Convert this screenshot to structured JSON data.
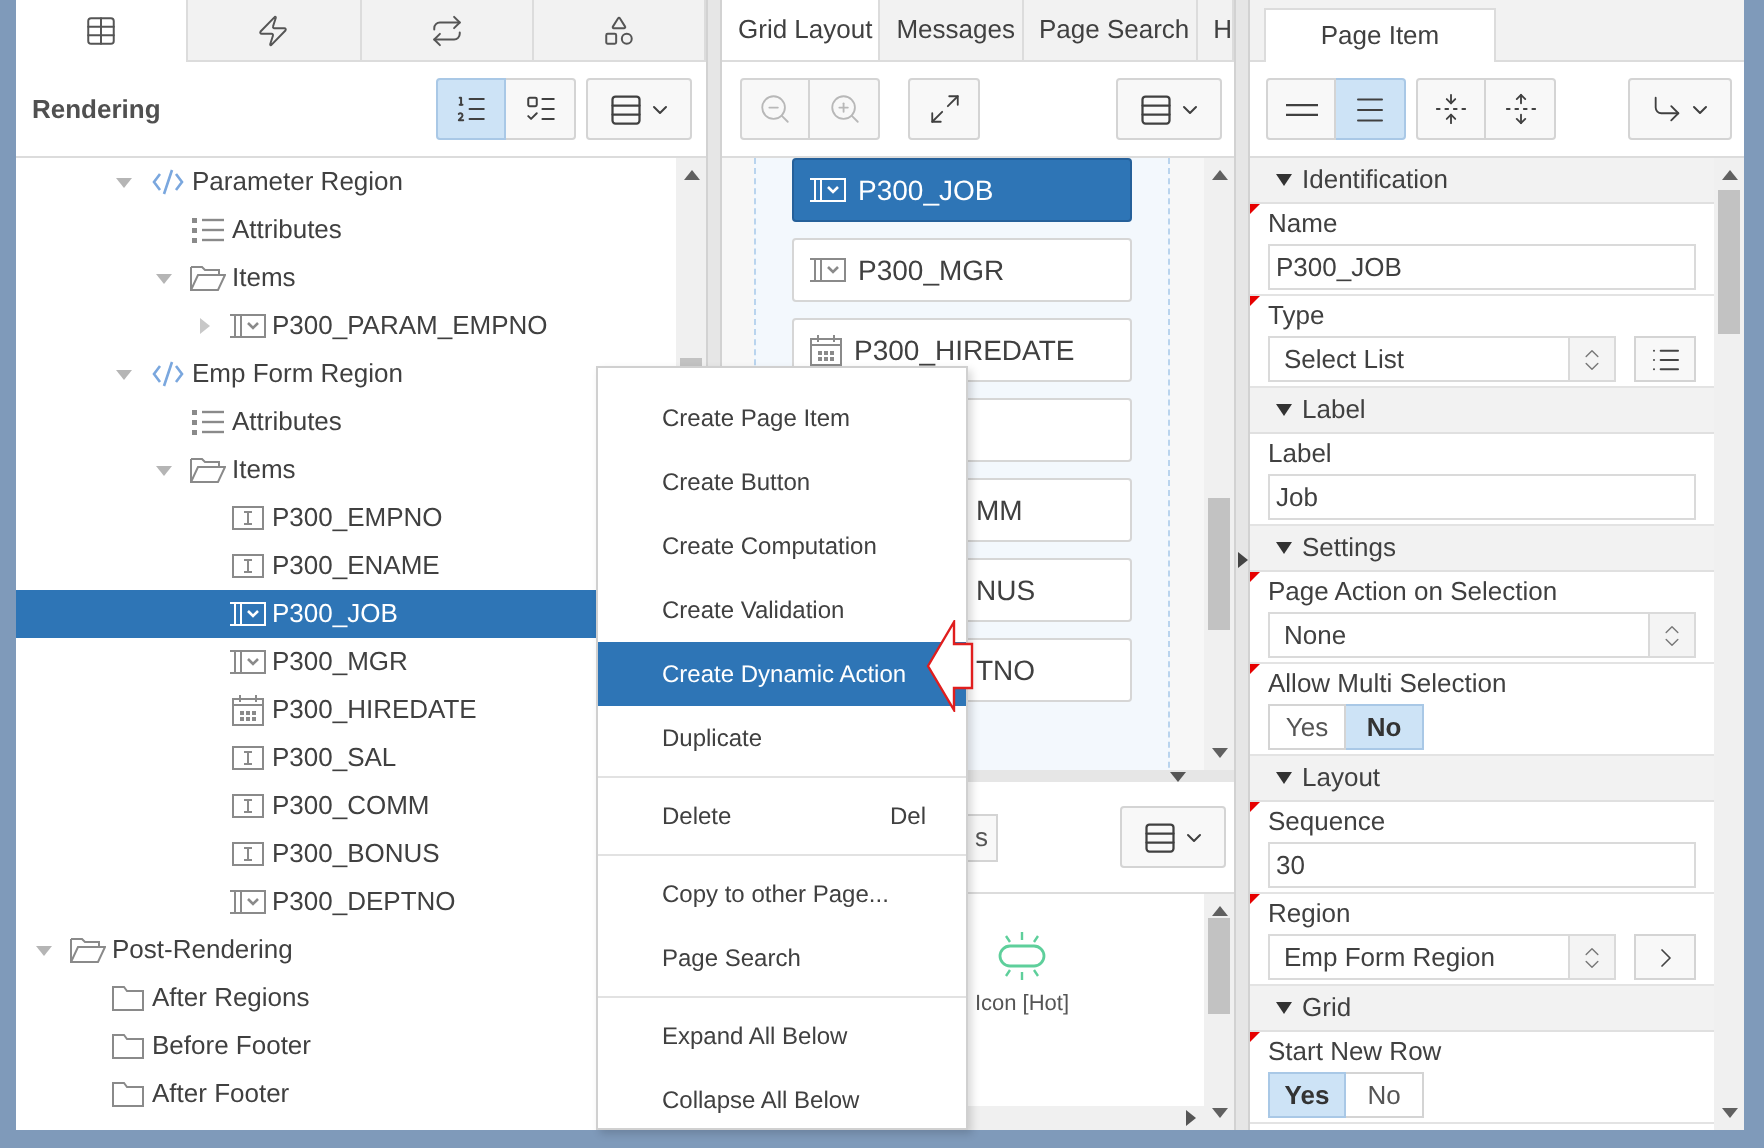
{
  "left_panel": {
    "tabs": [
      {
        "kind": "rendering",
        "selected": true
      },
      {
        "kind": "dynamic_actions",
        "selected": false
      },
      {
        "kind": "processing",
        "selected": false
      },
      {
        "kind": "shared_components",
        "selected": false
      }
    ],
    "title": "Rendering",
    "view_toggles": [
      {
        "kind": "numbered",
        "selected": true
      },
      {
        "kind": "shapes",
        "selected": false
      }
    ],
    "tree": [
      {
        "children": [
          {
            "children": [
              {
                "label": "Parameter Region",
                "kind": "region",
                "expanded": true,
                "selected": false,
                "children": [
                  {
                    "label": "Attributes",
                    "kind": "attributes",
                    "selected": false
                  },
                  {
                    "label": "Items",
                    "kind": "folder",
                    "expanded": true,
                    "selected": false,
                    "children": [
                      {
                        "label": "P300_PARAM_EMPNO",
                        "kind": "select",
                        "expanded": false,
                        "selected": false
                      }
                    ]
                  }
                ]
              },
              {
                "label": "Emp Form Region",
                "kind": "region",
                "expanded": true,
                "selected": false,
                "children": [
                  {
                    "label": "Attributes",
                    "kind": "attributes",
                    "selected": false
                  },
                  {
                    "label": "Items",
                    "kind": "folder",
                    "expanded": true,
                    "selected": false,
                    "children": [
                      {
                        "label": "P300_EMPNO",
                        "kind": "text",
                        "selected": false
                      },
                      {
                        "label": "P300_ENAME",
                        "kind": "text",
                        "selected": false
                      },
                      {
                        "label": "P300_JOB",
                        "kind": "select",
                        "selected": true
                      },
                      {
                        "label": "P300_MGR",
                        "kind": "select",
                        "selected": false
                      },
                      {
                        "label": "P300_HIREDATE",
                        "kind": "date",
                        "selected": false
                      },
                      {
                        "label": "P300_SAL",
                        "kind": "text",
                        "selected": false
                      },
                      {
                        "label": "P300_COMM",
                        "kind": "text",
                        "selected": false
                      },
                      {
                        "label": "P300_BONUS",
                        "kind": "text",
                        "selected": false
                      },
                      {
                        "label": "P300_DEPTNO",
                        "kind": "select",
                        "selected": false
                      }
                    ]
                  }
                ]
              }
            ]
          }
        ]
      },
      {
        "label": "Post-Rendering",
        "kind": "folder",
        "expanded": true,
        "selected": false,
        "children": [
          {
            "label": "After Regions",
            "kind": "folder",
            "selected": false
          },
          {
            "label": "Before Footer",
            "kind": "folder",
            "selected": false
          },
          {
            "label": "After Footer",
            "kind": "folder",
            "selected": false
          }
        ]
      }
    ]
  },
  "middle_panel": {
    "tabs": [
      {
        "label": "Grid Layout",
        "selected": true
      },
      {
        "label": "Messages",
        "selected": false
      },
      {
        "label": "Page Search",
        "selected": false
      },
      {
        "label": "H",
        "selected": false
      }
    ],
    "toolbar": [
      {
        "kind": "zoom_out",
        "disabled": true
      },
      {
        "kind": "zoom_in",
        "disabled": true
      },
      {
        "kind": "expand",
        "disabled": false
      }
    ],
    "cards": [
      {
        "label": "P300_JOB",
        "kind": "select",
        "selected": true
      },
      {
        "label": "P300_MGR",
        "kind": "select",
        "selected": false
      },
      {
        "label": "P300_HIREDATE",
        "kind": "date",
        "selected": false
      },
      {
        "selected": false
      },
      {
        "label": "MM",
        "selected": false
      },
      {
        "label": "NUS",
        "selected": false
      },
      {
        "label": "TNO",
        "selected": false
      }
    ],
    "gallery_button": "s",
    "gallery": [
      {
        "label": "Icon [Hot]"
      }
    ]
  },
  "right_panel": {
    "tab": {
      "label": "Page Item",
      "selected": true
    },
    "toolbar_toggles": [
      {
        "kind": "compact",
        "selected": false
      },
      {
        "kind": "full",
        "selected": true
      }
    ],
    "sections": [
      {
        "title": "Identification",
        "fields": [
          {
            "label": "Name",
            "required": true,
            "kind": "text",
            "value": "P300_JOB"
          },
          {
            "label": "Type",
            "required": true,
            "kind": "select",
            "value": "Select List",
            "button": {
              "kind": "list"
            }
          }
        ]
      },
      {
        "title": "Label",
        "fields": [
          {
            "label": "Label",
            "required": false,
            "kind": "text",
            "value": "Job"
          }
        ]
      },
      {
        "title": "Settings",
        "fields": [
          {
            "label": "Page Action on Selection",
            "required": true,
            "kind": "select",
            "value": "None"
          },
          {
            "label": "Allow Multi Selection",
            "required": true,
            "kind": "switch",
            "options": [
              {
                "label": "Yes",
                "selected": false
              },
              {
                "label": "No",
                "selected": true
              }
            ]
          }
        ]
      },
      {
        "title": "Layout",
        "fields": [
          {
            "label": "Sequence",
            "required": true,
            "kind": "text",
            "value": "30"
          },
          {
            "label": "Region",
            "required": true,
            "kind": "select",
            "value": "Emp Form Region",
            "button": {
              "kind": "go"
            }
          }
        ]
      },
      {
        "title": "Grid",
        "fields": [
          {
            "label": "Start New Row",
            "required": true,
            "kind": "switch",
            "options": [
              {
                "label": "Yes",
                "selected": true
              },
              {
                "label": "No",
                "selected": false
              }
            ]
          }
        ]
      }
    ]
  },
  "context_menu": {
    "groups": [
      [
        {
          "label": "Create Page Item",
          "selected": false
        },
        {
          "label": "Create Button",
          "selected": false
        },
        {
          "label": "Create Computation",
          "selected": false
        },
        {
          "label": "Create Validation",
          "selected": false
        },
        {
          "label": "Create Dynamic Action",
          "selected": true
        },
        {
          "label": "Duplicate",
          "selected": false
        }
      ],
      [
        {
          "label": "Delete",
          "shortcut": "Del",
          "selected": false
        }
      ],
      [
        {
          "label": "Copy to other Page...",
          "selected": false
        },
        {
          "label": "Page Search",
          "selected": false
        }
      ],
      [
        {
          "label": "Expand All Below",
          "selected": false
        },
        {
          "label": "Collapse All Below",
          "selected": false
        }
      ]
    ]
  }
}
